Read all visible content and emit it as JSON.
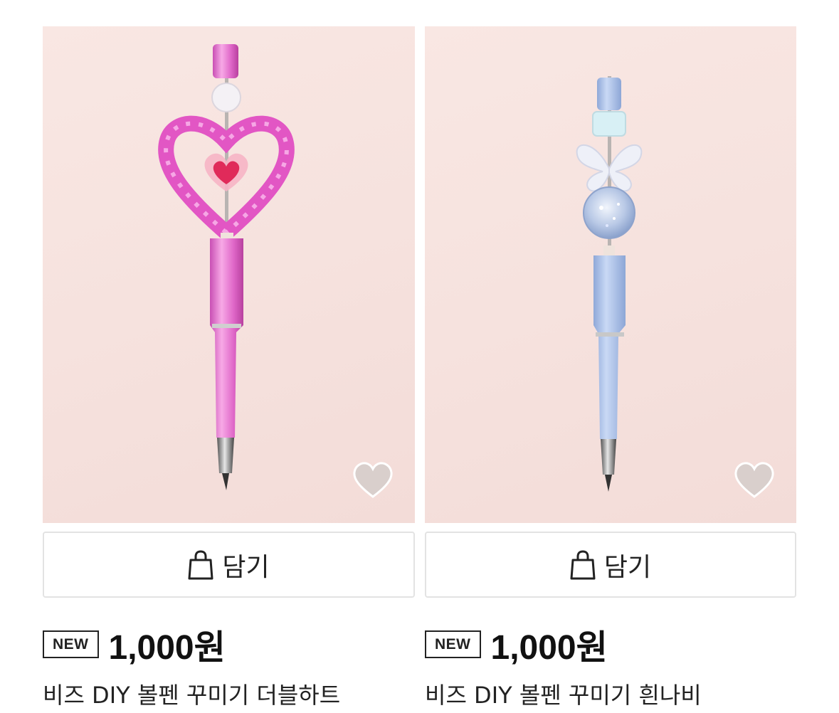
{
  "products": [
    {
      "cart_label": "담기",
      "badge": "NEW",
      "price": "1,000원",
      "name": "비즈 DIY 볼펜 꾸미기 더블하트",
      "accent": "#e56fcf",
      "image": "pink-heart-bead-pen"
    },
    {
      "cart_label": "담기",
      "badge": "NEW",
      "price": "1,000원",
      "name": "비즈 DIY 볼펜 꾸미기 흰나비",
      "accent": "#a7c1e8",
      "image": "blue-butterfly-bead-pen"
    }
  ],
  "icons": {
    "wishlist": "heart-icon",
    "cart": "shopping-bag-icon"
  }
}
